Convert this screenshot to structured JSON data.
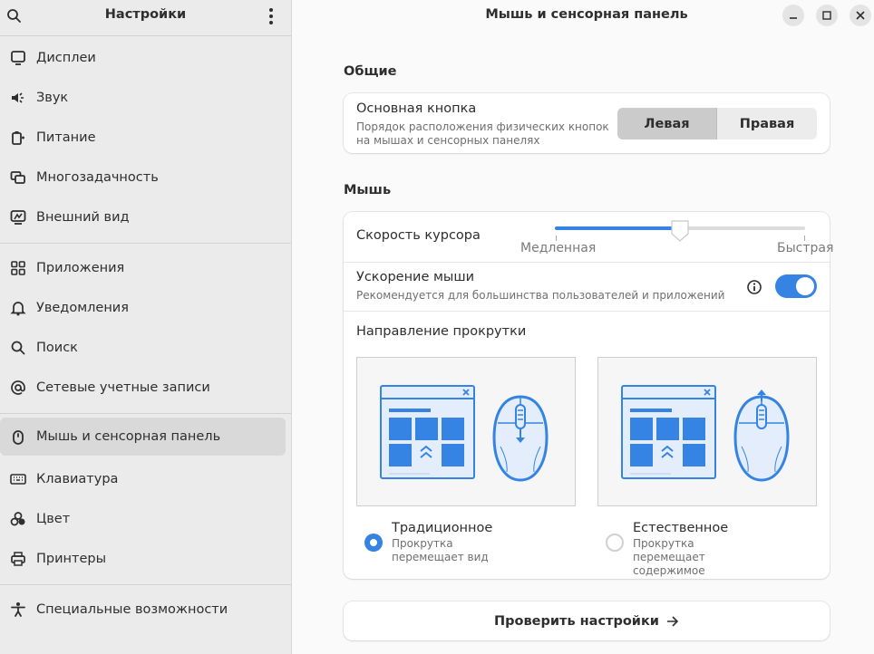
{
  "sidebar": {
    "title": "Настройки",
    "groups": [
      [
        {
          "label": "Дисплеи",
          "icon": "display-icon"
        },
        {
          "label": "Звук",
          "icon": "speaker-icon"
        },
        {
          "label": "Питание",
          "icon": "battery-icon"
        },
        {
          "label": "Многозадачность",
          "icon": "multitasking-icon"
        },
        {
          "label": "Внешний вид",
          "icon": "appearance-icon"
        }
      ],
      [
        {
          "label": "Приложения",
          "icon": "apps-icon"
        },
        {
          "label": "Уведомления",
          "icon": "bell-icon"
        },
        {
          "label": "Поиск",
          "icon": "search-icon"
        },
        {
          "label": "Сетевые учетные записи",
          "icon": "at-icon"
        }
      ],
      [
        {
          "label": "Мышь и сенсорная панель",
          "icon": "mouse-icon",
          "active": true
        },
        {
          "label": "Клавиатура",
          "icon": "keyboard-icon"
        },
        {
          "label": "Цвет",
          "icon": "color-icon"
        },
        {
          "label": "Принтеры",
          "icon": "printer-icon"
        }
      ],
      [
        {
          "label": "Специальные возможности",
          "icon": "accessibility-icon"
        }
      ]
    ]
  },
  "main": {
    "title": "Мышь и сенсорная панель",
    "general": {
      "heading": "Общие",
      "primary_button": {
        "title": "Основная кнопка",
        "subtitle": "Порядок расположения физических кнопок на мышах и сенсорных панелях",
        "options": [
          "Левая",
          "Правая"
        ],
        "selected": "Левая"
      }
    },
    "mouse": {
      "heading": "Мышь",
      "speed": {
        "title": "Скорость курсора",
        "min_label": "Медленная",
        "max_label": "Быстрая",
        "value": 0.5
      },
      "acceleration": {
        "title": "Ускорение мыши",
        "subtitle": "Рекомендуется для большинства пользователей и приложений",
        "enabled": true
      },
      "scroll": {
        "title": "Направление прокрутки",
        "traditional": {
          "label": "Традиционное",
          "desc": "Прокрутка перемещает вид",
          "selected": true
        },
        "natural": {
          "label": "Естественное",
          "desc": "Прокрутка перемещает содержимое",
          "selected": false
        }
      }
    },
    "test_button": "Проверить настройки",
    "accent": "#3584e4"
  }
}
